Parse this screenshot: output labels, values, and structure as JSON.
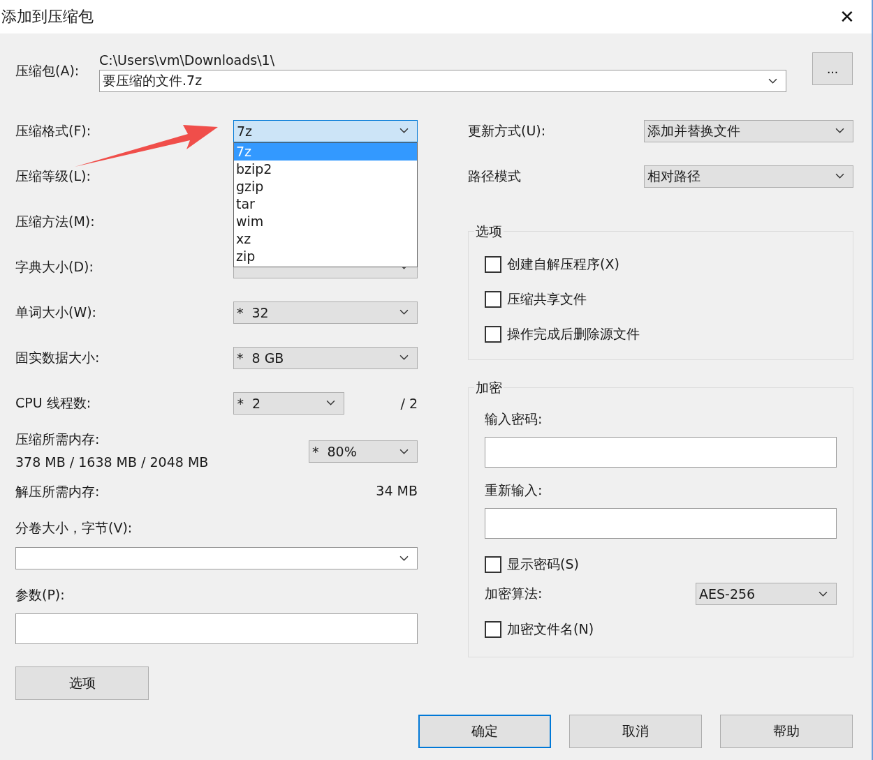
{
  "window": {
    "title": "添加到压缩包",
    "close": "✕"
  },
  "archive": {
    "label": "压缩包(A):",
    "path": "C:\\Users\\vm\\Downloads\\1\\",
    "value": "要压缩的文件.7z",
    "browse": "..."
  },
  "format": {
    "label": "压缩格式(F):",
    "value": "7z",
    "expanded": true,
    "options": [
      {
        "label": "7z",
        "selected": true
      },
      {
        "label": "bzip2",
        "selected": false
      },
      {
        "label": "gzip",
        "selected": false
      },
      {
        "label": "tar",
        "selected": false
      },
      {
        "label": "wim",
        "selected": false
      },
      {
        "label": "xz",
        "selected": false
      },
      {
        "label": "zip",
        "selected": false
      }
    ]
  },
  "settings": [
    {
      "kind": "hidden",
      "label": "压缩等级(L):"
    },
    {
      "kind": "hidden",
      "label": "压缩方法(M):"
    },
    {
      "kind": "covered",
      "label": "字典大小(D):"
    },
    {
      "kind": "combo",
      "label": "单词大小(W):",
      "star": "*",
      "value": "32"
    },
    {
      "kind": "combo",
      "label": "固实数据大小:",
      "star": "*",
      "value": "8 GB"
    },
    {
      "kind": "threads",
      "label": "CPU 线程数:",
      "star": "*",
      "value": "2",
      "suffix": "/ 2"
    },
    {
      "kind": "memory",
      "label": "压缩所需内存:",
      "detail": "378 MB / 1638 MB / 2048 MB",
      "star": "*",
      "value": "80%"
    },
    {
      "kind": "reading",
      "label": "解压所需内存:",
      "reading": "34 MB"
    }
  ],
  "volume": {
    "label": "分卷大小，字节(V):"
  },
  "parameters": {
    "label": "参数(P):"
  },
  "options_button": "选项",
  "update": {
    "label": "更新方式(U):",
    "value": "添加并替换文件"
  },
  "path_mode": {
    "label": "路径模式",
    "value": "相对路径"
  },
  "options_group": {
    "title": "选项",
    "checkboxes": [
      {
        "label": "创建自解压程序(X)",
        "checked": false
      },
      {
        "label": "压缩共享文件",
        "checked": false
      },
      {
        "label": "操作完成后删除源文件",
        "checked": false
      }
    ]
  },
  "encryption": {
    "title": "加密",
    "password_label": "输入密码:",
    "reenter_label": "重新输入:",
    "show_password": {
      "label": "显示密码(S)",
      "checked": false
    },
    "method_label": "加密算法:",
    "method": "AES-256",
    "encrypt_names": {
      "label": "加密文件名(N)",
      "checked": false
    }
  },
  "buttons": [
    {
      "label": "确定",
      "default": true
    },
    {
      "label": "取消",
      "default": false
    },
    {
      "label": "帮助",
      "default": false
    }
  ]
}
